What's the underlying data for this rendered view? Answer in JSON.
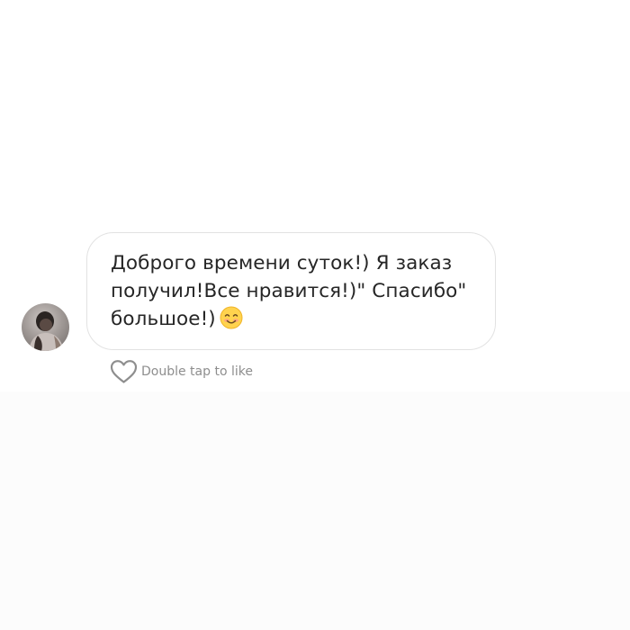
{
  "message": {
    "lines": [
      "Доброго времени суток!) Я заказ",
      "получил!Все нравится!)\" Спасибо\"",
      "большое!)"
    ],
    "emoji": "smiling-face-with-smiling-eyes"
  },
  "like": {
    "label": "Double tap to like",
    "icon": "heart-outline-icon"
  },
  "avatar": {
    "icon": "user-avatar"
  },
  "colors": {
    "text": "#262626",
    "secondary_text": "#8e8e8e",
    "bubble_border": "#e2e2e2",
    "background": "#ffffff"
  }
}
